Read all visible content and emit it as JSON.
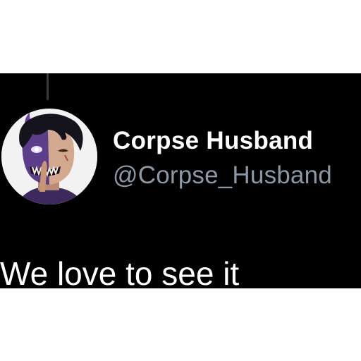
{
  "tweet": {
    "author": {
      "display_name": "Corpse Husband",
      "handle": "@Corpse_Husband",
      "avatar_icon": "avatar-illustration-icon"
    },
    "text": "We love to see it"
  },
  "colors": {
    "card_background": "#000000",
    "page_background": "#ffffff",
    "name_color": "#ffffff",
    "handle_color": "#8b98a5",
    "thread_line": "#3a3a3a"
  }
}
